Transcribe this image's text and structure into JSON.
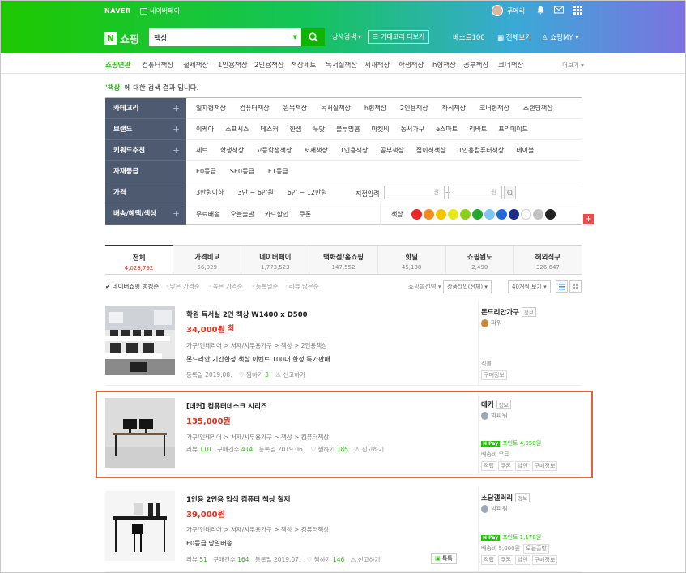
{
  "header": {
    "naver_logo": "NAVER",
    "npay_link": "네이버페이",
    "user_name": "푸에리",
    "logo_n": "N",
    "logo_text": "쇼핑",
    "search_value": "책상",
    "detail_search": "상세검색 ▾",
    "category_more": "카테고리 더보기",
    "best100": "베스트100",
    "all_view": "전체보기",
    "my_shopping": "쇼핑MY ▾"
  },
  "gnb": {
    "items": [
      "쇼핑연관",
      "컴퓨터책상",
      "철제책상",
      "1인용책상",
      "2인용책상",
      "책상세트",
      "독서실책상",
      "서재책상",
      "학생책상",
      "h형책상",
      "공부책상",
      "코너책상"
    ],
    "more": "더보기 ▾"
  },
  "result": {
    "keyword": "'책상'",
    "suffix": " 에 대한 검색 결과 입니다."
  },
  "filter": {
    "rows": [
      {
        "label": "카테고리",
        "plus": "+",
        "options": [
          "일자형책상",
          "컴퓨터책상",
          "원목책상",
          "독서실책상",
          "h형책상",
          "2인용책상",
          "좌식책상",
          "코너형책상",
          "스탠딩책상"
        ]
      },
      {
        "label": "브랜드",
        "plus": "+",
        "options": [
          "이케아",
          "소프시스",
          "데스커",
          "한샘",
          "두닷",
          "블루밍홈",
          "마켓비",
          "동서가구",
          "e스마트",
          "리바트",
          "프리메이드"
        ]
      },
      {
        "label": "키워드추천",
        "plus": "+",
        "options": [
          "세트",
          "학생책상",
          "고등학생책상",
          "서재책상",
          "1인용책상",
          "공부책상",
          "접이식책상",
          "1인용컴퓨터책상",
          "테이블"
        ]
      },
      {
        "label": "자재등급",
        "plus": "",
        "options": [
          "E0등급",
          "SE0등급",
          "E1등급"
        ]
      },
      {
        "label": "가격",
        "plus": "",
        "options": [
          "3만원이하",
          "3만 ~ 6만원",
          "6만 ~ 12만원"
        ],
        "direct": "직접입력",
        "won": "원",
        "tilde": "~"
      },
      {
        "label": "배송/혜택/색상",
        "plus": "+",
        "options": [
          "무료배송",
          "오늘출발",
          "카드할인",
          "쿠폰"
        ],
        "color_label": "색상"
      }
    ],
    "colors": [
      "#e8262b",
      "#f28c1c",
      "#f5c400",
      "#e8e818",
      "#8ccf18",
      "#22a92a",
      "#7fc6ef",
      "#2168d8",
      "#1d2e8a",
      "#ffffff",
      "#c3c3c3",
      "#222222"
    ]
  },
  "tabs": [
    {
      "name": "전체",
      "count": "4,023,792"
    },
    {
      "name": "가격비교",
      "count": "56,029"
    },
    {
      "name": "네이버페이",
      "count": "1,773,523"
    },
    {
      "name": "백화점/홈쇼핑",
      "count": "147,552"
    },
    {
      "name": "핫딜",
      "count": "45,138"
    },
    {
      "name": "쇼핑윈도",
      "count": "2,490"
    },
    {
      "name": "해외직구",
      "count": "326,647"
    }
  ],
  "sort": {
    "items": [
      "✔ 네이버쇼핑 랭킹순",
      "· 낮은 가격순",
      "· 높은 가격순",
      "· 등록일순",
      "· 리뷰 많은순"
    ],
    "mall_select": "쇼핑몰선택 ▾",
    "type_select": "상품타입(전체) ▾",
    "count_select": "40개씩 보기 ▾"
  },
  "products": [
    {
      "title": "학원 독서실 2인 책상 W1400 x D500",
      "price": "34,000원",
      "price_extra": "최",
      "category": "가구/인테리어 > 서재/사무용가구 > 책상 > 2인용책상",
      "desc": "몬드리안 기간한정 책상 이벤트 100대 한정 특가판매",
      "meta_prefix": "등록일 2019.08.",
      "zzim": "찜하기",
      "zzim_count": "3",
      "report": "신고하기",
      "seller": "몬드리안가구",
      "seller_info": "정보",
      "grade": "파워",
      "seller_line1": "직볼",
      "seller_tags": [
        "구매정보"
      ]
    },
    {
      "title": "[데커] 컴퓨터데스크 시리즈",
      "price": "135,000원",
      "category": "가구/인테리어 > 서재/사무용가구 > 책상 > 컴퓨터책상",
      "review_label": "리뷰",
      "review": "110",
      "buy_label": "구매건수",
      "buy": "414",
      "date": "등록일 2019.06.",
      "zzim": "찜하기",
      "zzim_count": "185",
      "report": "신고하기",
      "seller": "데커",
      "seller_info": "정보",
      "grade": "빅파워",
      "npay": "N Pay",
      "point": "포인트 4,050원",
      "shipping": "배송비 무료",
      "seller_tags": [
        "적립",
        "쿠폰",
        "할인",
        "구매정보"
      ]
    },
    {
      "title": "1인용 2인용 입식 컴퓨터 책상 철제",
      "price": "39,000원",
      "category": "가구/인테리어 > 서재/사무용가구 > 책상 > 컴퓨터책상",
      "desc": "E0등급 당일배송",
      "review_label": "리뷰",
      "review": "51",
      "buy_label": "구매건수",
      "buy": "164",
      "date": "등록일 2019.07.",
      "zzim": "찜하기",
      "zzim_count": "146",
      "report": "신고하기",
      "talk": "톡톡",
      "seller": "소담갤러리",
      "seller_info": "정보",
      "grade": "빅파워",
      "npay": "N Pay",
      "point": "포인트 1,170원",
      "shipping": "배송비 5,000원",
      "shipping2": "오늘출발",
      "seller_tags": [
        "적립",
        "쿠폰",
        "할인",
        "구매정보"
      ]
    }
  ]
}
